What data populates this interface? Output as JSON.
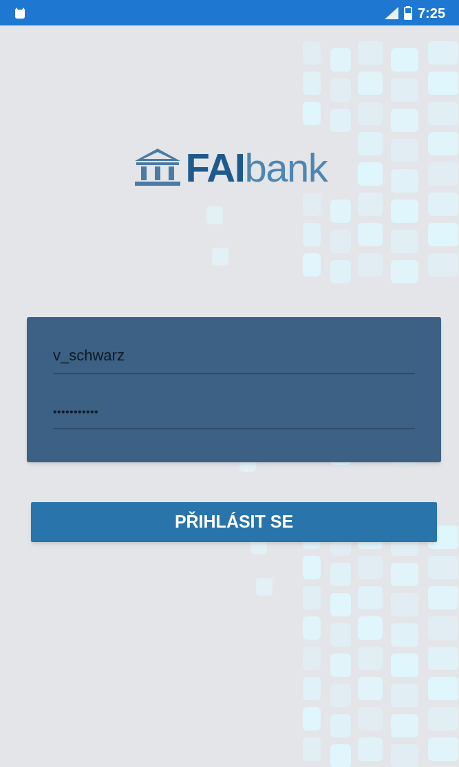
{
  "status_bar": {
    "time": "7:25"
  },
  "logo": {
    "bold": "FAI",
    "light": "bank"
  },
  "login_form": {
    "username": {
      "value": "v_schwarz"
    },
    "password": {
      "value": "•••••••••••"
    }
  },
  "login_button": {
    "label": "PŘIHLÁSIT SE"
  }
}
